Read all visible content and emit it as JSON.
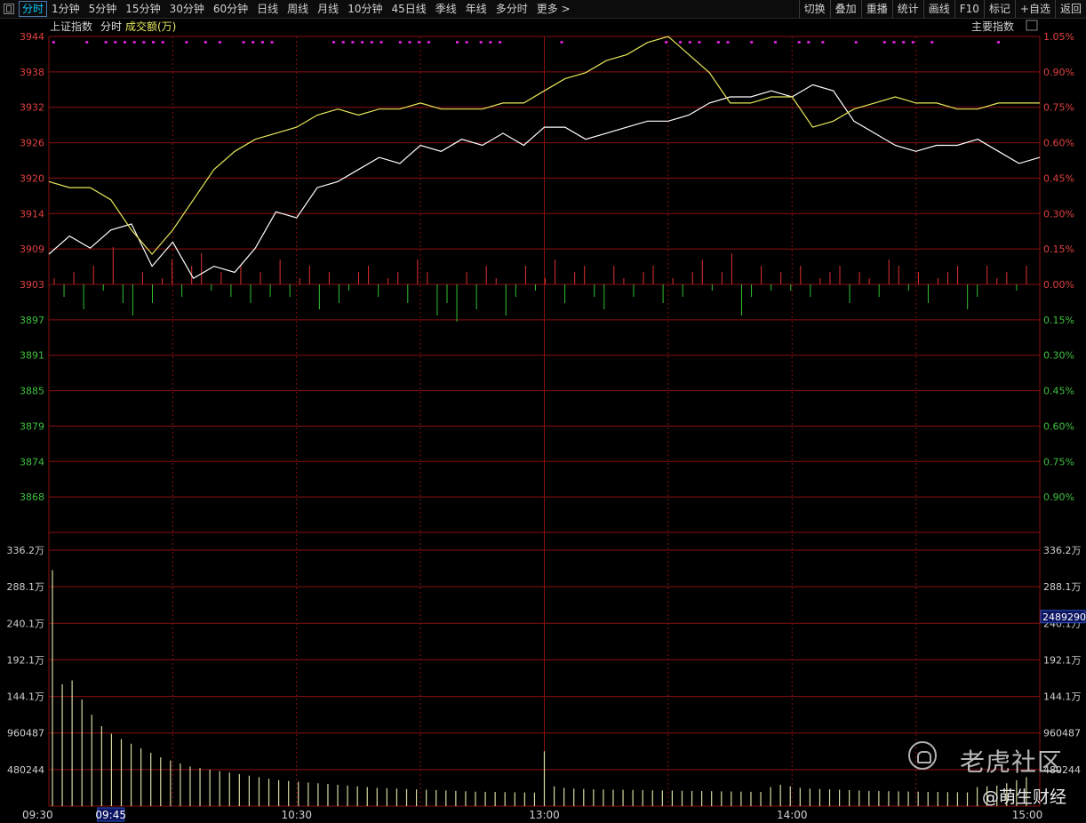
{
  "toolbar": {
    "left_items": [
      "分时",
      "1分钟",
      "5分钟",
      "15分钟",
      "30分钟",
      "60分钟",
      "日线",
      "周线",
      "月线",
      "10分钟",
      "45日线",
      "季线",
      "年线",
      "多分时",
      "更多 >"
    ],
    "active": "分时",
    "right_items": [
      "切换",
      "叠加",
      "重播",
      "统计",
      "画线",
      "F10",
      "标记",
      "+自选",
      "返回"
    ]
  },
  "header": {
    "index_name": "上证指数",
    "mode": "分时",
    "volume_label": "成交额(万)",
    "indicator_button": "主要指数"
  },
  "watermark": {
    "brand": "老虎社区",
    "author": "@萌生财经"
  },
  "colors": {
    "background": "#000000",
    "grid": "#8a1111",
    "up": "#e03030",
    "down": "#30c030",
    "price_line": "#ffffff",
    "avg_line": "#e8e85a",
    "volume": "#d8d8a0",
    "marker": "#d020d0",
    "up_label": "#e04040",
    "down_label": "#40c040"
  },
  "chart_data": {
    "type": "line",
    "title": "上证指数 分时",
    "prev_close": 3903,
    "price_axis": {
      "left_ticks": [
        "3944",
        "3938",
        "3932",
        "3926",
        "3920",
        "3914",
        "3909",
        "3903",
        "3897",
        "3891",
        "3885",
        "3879",
        "3874",
        "3868"
      ],
      "right_ticks": [
        "1.05%",
        "0.90%",
        "0.75%",
        "0.60%",
        "0.45%",
        "0.30%",
        "0.15%",
        "0.00%",
        "0.15%",
        "0.30%",
        "0.45%",
        "0.60%",
        "0.75%",
        "0.90%"
      ],
      "range": [
        3862,
        3944
      ]
    },
    "volume_axis": {
      "ticks": [
        "336.2万",
        "288.1万",
        "240.1万",
        "192.1万",
        "144.1万",
        "960487",
        "480244"
      ],
      "range": [
        0,
        3362000
      ],
      "current_label": "2489290"
    },
    "time_axis": {
      "labels": [
        "09:30",
        "10:30",
        "13:00",
        "14:00",
        "15:00"
      ],
      "cursor_label": "09:45"
    },
    "series": [
      {
        "name": "上证指数",
        "x": [
          0,
          5,
          10,
          15,
          20,
          25,
          30,
          35,
          40,
          45,
          50,
          55,
          60,
          65,
          70,
          75,
          80,
          85,
          90,
          95,
          100,
          105,
          110,
          115,
          120,
          125,
          130,
          135,
          140,
          145,
          150,
          155,
          160,
          165,
          170,
          175,
          180,
          185,
          190,
          195,
          200,
          205,
          210,
          215,
          220,
          225,
          230,
          235,
          240
        ],
        "values": [
          3908,
          3911,
          3909,
          3912,
          3913,
          3906,
          3910,
          3904,
          3906,
          3905,
          3909,
          3915,
          3914,
          3919,
          3920,
          3922,
          3924,
          3923,
          3926,
          3925,
          3927,
          3926,
          3928,
          3926,
          3929,
          3929,
          3927,
          3928,
          3929,
          3930,
          3930,
          3931,
          3933,
          3934,
          3934,
          3935,
          3934,
          3936,
          3935,
          3930,
          3928,
          3926,
          3925,
          3926,
          3926,
          3927,
          3925,
          3923,
          3924
        ]
      },
      {
        "name": "均价",
        "x": [
          0,
          5,
          10,
          15,
          20,
          25,
          30,
          35,
          40,
          45,
          50,
          55,
          60,
          65,
          70,
          75,
          80,
          85,
          90,
          95,
          100,
          105,
          110,
          115,
          120,
          125,
          130,
          135,
          140,
          145,
          150,
          155,
          160,
          165,
          170,
          175,
          180,
          185,
          190,
          195,
          200,
          205,
          210,
          215,
          220,
          225,
          230,
          235,
          240
        ],
        "values": [
          3920,
          3919,
          3919,
          3917,
          3912,
          3908,
          3912,
          3917,
          3922,
          3925,
          3927,
          3928,
          3929,
          3931,
          3932,
          3931,
          3932,
          3932,
          3933,
          3932,
          3932,
          3932,
          3933,
          3933,
          3935,
          3937,
          3938,
          3940,
          3941,
          3943,
          3944,
          3941,
          3938,
          3933,
          3933,
          3934,
          3934,
          3929,
          3930,
          3932,
          3933,
          3934,
          3933,
          3933,
          3932,
          3932,
          3933,
          3933,
          3933
        ]
      }
    ],
    "diff_bars": [
      1,
      -2,
      2,
      -4,
      3,
      -1,
      6,
      -3,
      -5,
      2,
      -3,
      1,
      4,
      -2,
      3,
      5,
      -1,
      2,
      -2,
      3,
      -3,
      2,
      -2,
      4,
      -2,
      1,
      3,
      -4,
      2,
      -3,
      -1,
      2,
      3,
      -2,
      1,
      2,
      -3,
      4,
      2,
      -5,
      -3,
      -6,
      2,
      -4,
      3,
      1,
      -5,
      -2,
      3,
      -1,
      1,
      4,
      -3,
      2,
      3,
      -2,
      -4,
      3,
      1,
      -2,
      2,
      3,
      -3,
      1,
      -2,
      2,
      4,
      -1,
      2,
      5,
      -5,
      -2,
      3,
      -1,
      2,
      -1,
      3,
      -2,
      1,
      2,
      3,
      -3,
      2,
      1,
      -2,
      4,
      3,
      -1,
      2,
      -3,
      1,
      2,
      3,
      -4,
      -2,
      3,
      1,
      2,
      -1,
      3
    ],
    "volume": [
      3100000,
      1600000,
      1650000,
      1400000,
      1200000,
      1050000,
      950000,
      880000,
      820000,
      760000,
      700000,
      640000,
      600000,
      560000,
      520000,
      500000,
      480000,
      460000,
      440000,
      420000,
      400000,
      380000,
      360000,
      340000,
      330000,
      320000,
      310000,
      300000,
      290000,
      280000,
      270000,
      260000,
      250000,
      240000,
      235000,
      230000,
      225000,
      220000,
      215000,
      210000,
      205000,
      200000,
      195000,
      190000,
      188000,
      186000,
      184000,
      182000,
      180000,
      178000,
      720000,
      260000,
      240000,
      230000,
      225000,
      220000,
      218000,
      216000,
      214000,
      212000,
      210000,
      208000,
      206000,
      204000,
      202000,
      200000,
      198000,
      196000,
      194000,
      192000,
      190000,
      188000,
      186000,
      250000,
      280000,
      260000,
      240000,
      230000,
      225000,
      220000,
      215000,
      210000,
      205000,
      200000,
      198000,
      196000,
      194000,
      192000,
      190000,
      188000,
      186000,
      184000,
      182000,
      180000,
      250000,
      260000,
      270000,
      300000,
      340000,
      380000
    ]
  }
}
